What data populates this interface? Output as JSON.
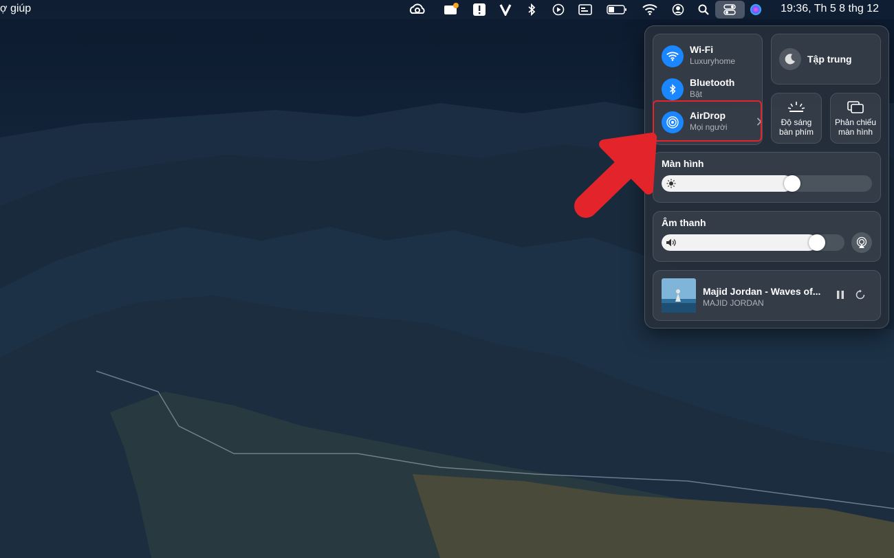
{
  "menubar": {
    "help_label": "ợ giúp",
    "clock": "19:36, Th 5 8 thg 12",
    "icons": [
      "creative-cloud-icon",
      "notification-app-icon",
      "alert-icon",
      "v-app-icon",
      "bluetooth-icon",
      "play-icon",
      "screen-record-icon",
      "battery-icon",
      "wifi-icon",
      "user-icon",
      "search-icon",
      "control-center-icon",
      "siri-icon"
    ]
  },
  "control_center": {
    "wifi": {
      "title": "Wi-Fi",
      "subtitle": "Luxuryhome"
    },
    "bluetooth": {
      "title": "Bluetooth",
      "subtitle": "Bật"
    },
    "airdrop": {
      "title": "AirDrop",
      "subtitle": "Mọi người"
    },
    "focus": {
      "label": "Tập trung"
    },
    "keyboard_brightness": {
      "line1": "Độ sáng",
      "line2": "bàn phím"
    },
    "screen_mirroring": {
      "line1": "Phản chiếu",
      "line2": "màn hình"
    },
    "display": {
      "title": "Màn hình",
      "level": 0.62
    },
    "sound": {
      "title": "Âm thanh",
      "level": 0.85
    },
    "now_playing": {
      "title": "Majid Jordan - Waves of...",
      "artist": "MAJID JORDAN"
    }
  },
  "colors": {
    "accent": "#1a86ff",
    "highlight": "#e3252b"
  }
}
